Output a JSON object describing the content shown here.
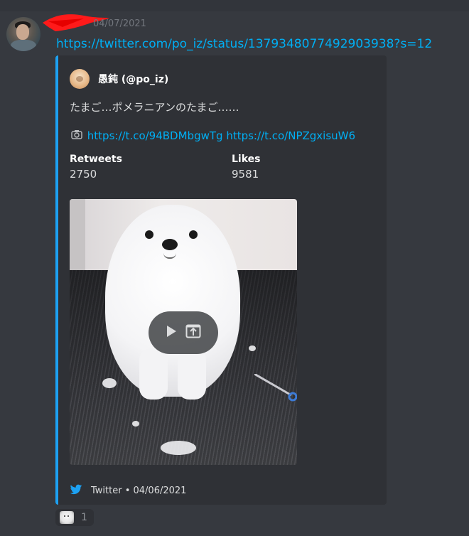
{
  "message": {
    "timestamp": "04/07/2021",
    "link": "https://twitter.com/po_iz/status/1379348077492903938?s=12"
  },
  "embed": {
    "author": "愚鈍 (@po_iz)",
    "description": "たまご…ポメラニアンのたまご……",
    "desc_icon": "camera-icon",
    "links": [
      "https://t.co/94BDMbgwTg",
      "https://t.co/NPZgxisuW6"
    ],
    "fields": [
      {
        "name": "Retweets",
        "value": "2750"
      },
      {
        "name": "Likes",
        "value": "9581"
      }
    ],
    "footer": {
      "icon": "twitter-icon",
      "text": "Twitter • 04/06/2021"
    },
    "accent_color": "#1da1f2"
  },
  "reaction": {
    "count": "1"
  },
  "colors": {
    "background": "#36393f",
    "embed_background": "#2f3136",
    "link": "#00aff4",
    "muted": "#72767d"
  }
}
